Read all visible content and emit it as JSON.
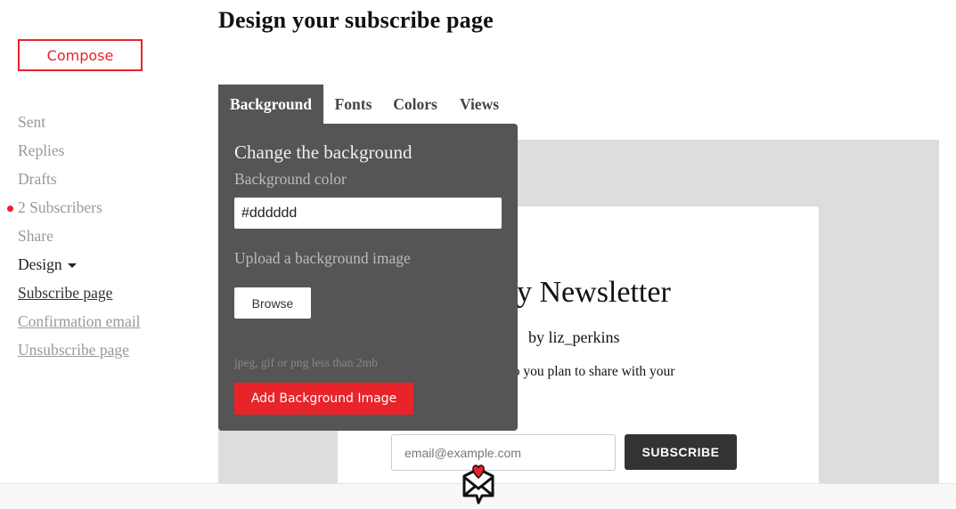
{
  "page": {
    "title": "Design your subscribe page"
  },
  "sidebar": {
    "compose_label": "Compose",
    "items": [
      {
        "label": "Sent"
      },
      {
        "label": "Replies"
      },
      {
        "label": "Drafts"
      },
      {
        "label": "2 Subscribers",
        "badge_color": "#e8232a"
      },
      {
        "label": "Share"
      },
      {
        "label": "Design"
      },
      {
        "label": "Subscribe page"
      },
      {
        "label": "Confirmation email"
      },
      {
        "label": "Unsubscribe page"
      }
    ]
  },
  "tabs": [
    {
      "label": "Background",
      "active": true
    },
    {
      "label": "Fonts"
    },
    {
      "label": "Colors"
    },
    {
      "label": "Views"
    }
  ],
  "panel": {
    "heading": "Change the background",
    "color_label": "Background color",
    "color_value": "#dddddd",
    "upload_label": "Upload a background image",
    "browse_label": "Browse",
    "hint": "jpeg, gif or png less than 2mb",
    "add_button": "Add Background Image"
  },
  "preview": {
    "title": "y Newsletter",
    "byline": "by liz_perkins",
    "description": "do you plan to share with your",
    "email_placeholder": "email@example.com",
    "subscribe_label": "SUBSCRIBE"
  },
  "colors": {
    "accent": "#e8232a",
    "panel": "#555555",
    "preview_bg": "#dddddd"
  }
}
